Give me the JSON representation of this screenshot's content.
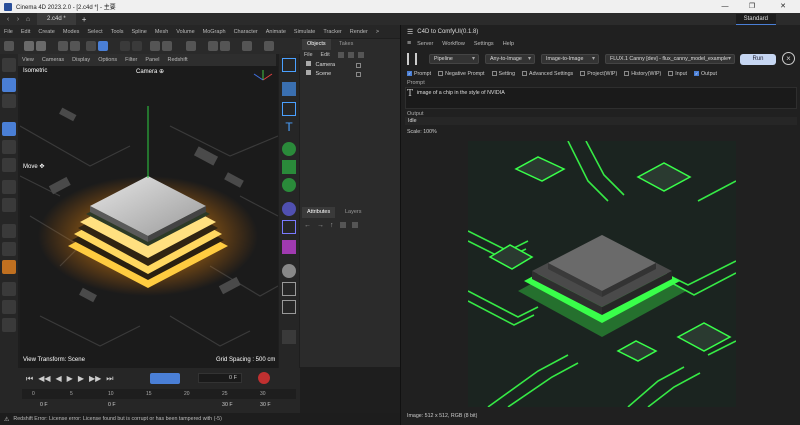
{
  "window": {
    "title": "Cinema 4D 2023.2.0 - [2.c4d *] - 主要",
    "controls": [
      "—",
      "❐",
      "✕"
    ]
  },
  "tabs": {
    "document": "2.c4d *",
    "layout": "Standard"
  },
  "menu": [
    "File",
    "Edit",
    "Create",
    "Modes",
    "Select",
    "Tools",
    "Spline",
    "Mesh",
    "Volume",
    "MoGraph",
    "Character",
    "Animate",
    "Simulate",
    "Tracker",
    "Render",
    ">"
  ],
  "viewport": {
    "menu": [
      "View",
      "Cameras",
      "Display",
      "Options",
      "Filter",
      "Panel",
      "Redshift"
    ],
    "projection": "Isometric",
    "camera": "Camera ⊕",
    "move_label": "Move ✥",
    "transform": "View Transform: Scene",
    "grid": "Grid Spacing : 500 cm"
  },
  "objects": {
    "tabs": [
      "Objects",
      "Takes"
    ],
    "menu": [
      "File",
      "Edit"
    ],
    "items": [
      {
        "name": "Camera"
      },
      {
        "name": "Scene"
      }
    ]
  },
  "attributes": {
    "tabs": [
      "Attributes",
      "Layers"
    ]
  },
  "timeline": {
    "frame_field": "0 F",
    "ruler": [
      "0",
      "5",
      "10",
      "15",
      "20",
      "25",
      "30"
    ],
    "start_field": "0 F",
    "mid_field": "0 F",
    "end_field_a": "30 F",
    "end_field_b": "30 F"
  },
  "status": {
    "message": "Redshift Error: License error: License found but is corrupt or has been tampered with (-5)"
  },
  "comfy": {
    "title": "C4D to ComfyUI(0.1.8)",
    "menu": [
      "Server",
      "Workflow",
      "Settings",
      "Help"
    ],
    "selects": {
      "pipeline": "Pipeline",
      "mode": "Any-to-Image",
      "type": "Image-to-Image",
      "model": "FLUX.1 Canny [dev] - flux_canny_model_example"
    },
    "run_label": "Run",
    "toggles": [
      {
        "label": "Prompt",
        "checked": true
      },
      {
        "label": "Negative Prompt",
        "checked": false
      },
      {
        "label": "Setting",
        "checked": false
      },
      {
        "label": "Advanced Settings",
        "checked": false
      },
      {
        "label": "Project(WIP)",
        "checked": false
      },
      {
        "label": "History(WIP)",
        "checked": false
      },
      {
        "label": "Input",
        "checked": false
      },
      {
        "label": "Output",
        "checked": true
      }
    ],
    "prompt_label": "Prompt",
    "prompt_text": "image of a chip in the style of NVIDIA",
    "output_label": "Output",
    "status": "Idle",
    "scale": "Scale: 100%",
    "image_info": "Image: 512 x 512, RGB (8 bit)"
  },
  "colors": {
    "accent": "#4a7fd6",
    "neon": "#39ff4a",
    "glow": "#ffb020"
  }
}
